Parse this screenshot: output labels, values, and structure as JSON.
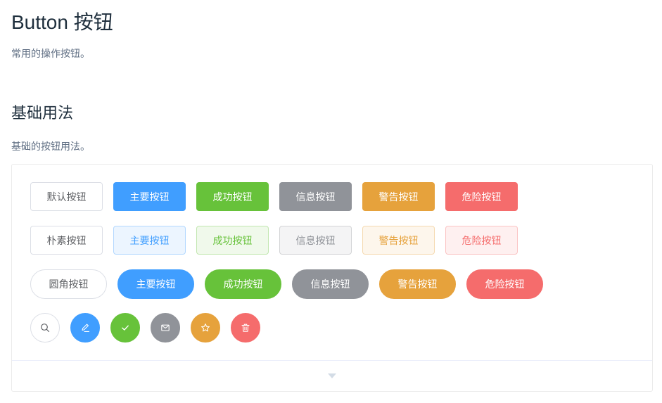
{
  "header": {
    "title": "Button 按钮",
    "description": "常用的操作按钮。"
  },
  "section": {
    "title": "基础用法",
    "description": "基础的按钮用法。"
  },
  "rows": {
    "basic": [
      "默认按钮",
      "主要按钮",
      "成功按钮",
      "信息按钮",
      "警告按钮",
      "危险按钮"
    ],
    "plain": [
      "朴素按钮",
      "主要按钮",
      "成功按钮",
      "信息按钮",
      "警告按钮",
      "危险按钮"
    ],
    "round": [
      "圆角按钮",
      "主要按钮",
      "成功按钮",
      "信息按钮",
      "警告按钮",
      "危险按钮"
    ],
    "circle_icons": [
      "search-icon",
      "edit-icon",
      "check-icon",
      "message-icon",
      "star-icon",
      "delete-icon"
    ]
  },
  "colors": {
    "default_border": "#dcdfe6",
    "primary": "#409eff",
    "success": "#67c23a",
    "info": "#909399",
    "warning": "#e6a23c",
    "danger": "#f56c6c"
  }
}
